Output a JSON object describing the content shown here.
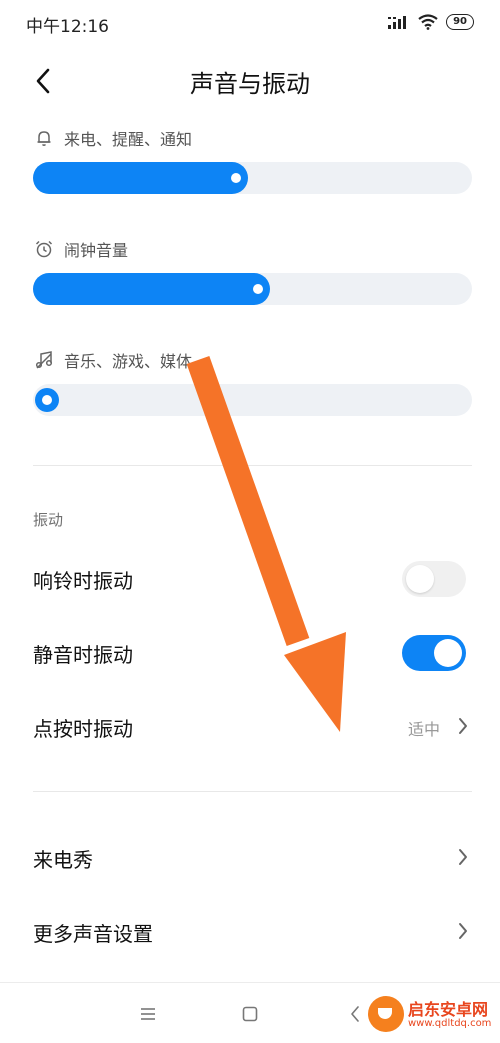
{
  "status_bar": {
    "time": "中午12:16",
    "battery": "90"
  },
  "header": {
    "title": "声音与振动"
  },
  "volume": [
    {
      "label": "来电、提醒、通知",
      "icon": "bell-icon",
      "level": 0.49
    },
    {
      "label": "闹钟音量",
      "icon": "alarm-clock-icon",
      "level": 0.54
    },
    {
      "label": "音乐、游戏、媒体",
      "icon": "music-note-icon",
      "level": 0.0
    }
  ],
  "vibration": {
    "section_title": "振动",
    "ring_vibrate": {
      "label": "响铃时振动",
      "on": false
    },
    "silent_vibrate": {
      "label": "静音时振动",
      "on": true
    },
    "touch_vibrate": {
      "label": "点按时振动",
      "value": "适中"
    }
  },
  "more": {
    "caller_show": "来电秀",
    "more_sound_settings": "更多声音设置"
  },
  "watermark": {
    "name": "启东安卓网",
    "url": "www.qdltdq.com"
  },
  "colors": {
    "accent": "#0d84f5",
    "arrow": "#f57328"
  }
}
